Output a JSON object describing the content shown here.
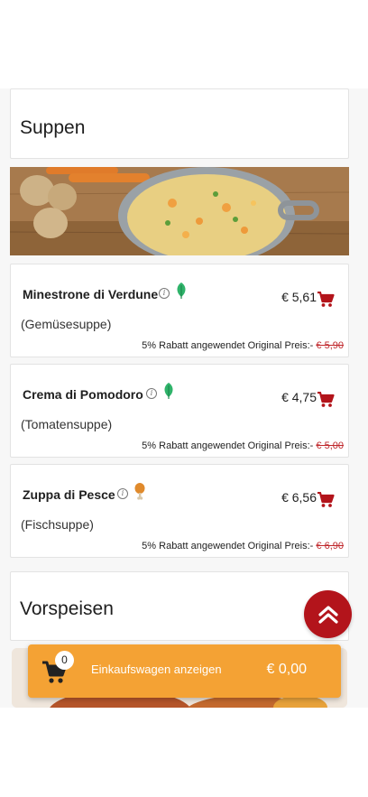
{
  "sections": {
    "soups_title": "Suppen",
    "starters_title": "Vorspeisen"
  },
  "items": [
    {
      "name": "Minestrone di Verdune",
      "description": "(Gemüsesuppe)",
      "price": "€ 5,61",
      "discount_text": "5% Rabatt angewendet Original Preis:-",
      "original_price": "€ 5,90",
      "diet_icon": "leaf-icon"
    },
    {
      "name": "Crema di Pomodoro",
      "description": "(Tomatensuppe)",
      "price": "€ 4,75",
      "discount_text": "5% Rabatt angewendet Original Preis:-",
      "original_price": "€ 5,00",
      "diet_icon": "leaf-icon"
    },
    {
      "name": "Zuppa di Pesce",
      "description": "(Fischsuppe)",
      "price": "€ 6,56",
      "discount_text": "5% Rabatt angewendet Original Preis:-",
      "original_price": "€ 6,90",
      "diet_icon": "chicken-leg-icon"
    }
  ],
  "cart": {
    "count": "0",
    "label": "Einkaufswagen anzeigen",
    "total": "€ 0,00"
  },
  "colors": {
    "accent_red": "#b3141b",
    "cart_orange": "#f4a234",
    "strike_red": "#c0282c",
    "leaf_green": "#2fb36a"
  }
}
